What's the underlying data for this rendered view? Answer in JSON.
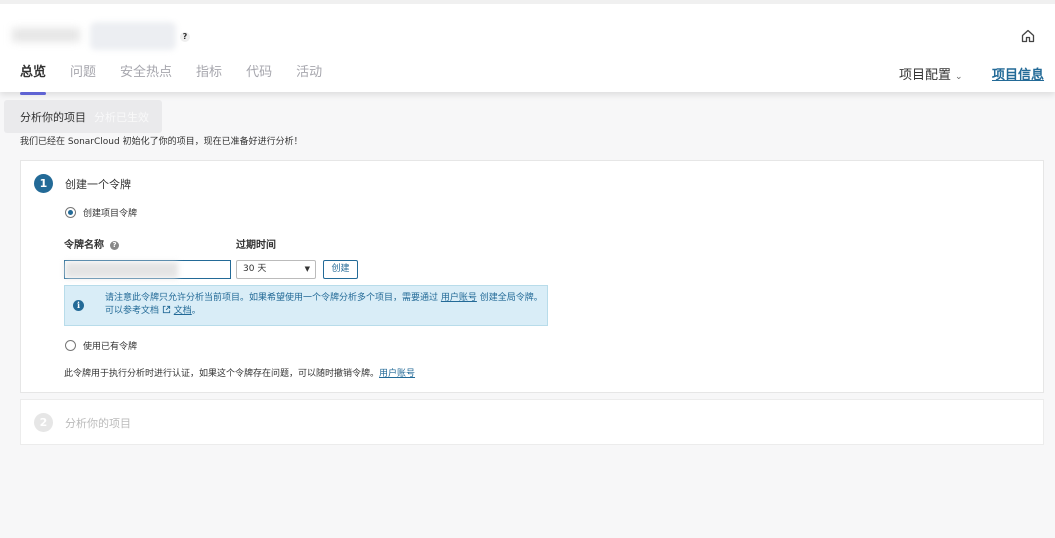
{
  "header": {
    "help_glyph": "?",
    "tabs": [
      {
        "label": "总览"
      },
      {
        "label": "问题"
      },
      {
        "label": "安全热点"
      },
      {
        "label": "指标"
      },
      {
        "label": "代码"
      },
      {
        "label": "活动"
      }
    ],
    "project_config": "项目配置",
    "project_info": "项目信息"
  },
  "page": {
    "title": "分析你的项目",
    "ghost_overlay": "分析已生效",
    "intro": "我们已经在 SonarCloud 初始化了你的项目，现在已准备好进行分析！"
  },
  "step1": {
    "number": "1",
    "title": "创建一个令牌",
    "radio_create": "创建项目令牌",
    "token_name_label": "令牌名称",
    "expiration_label": "过期时间",
    "expiration_value": "30 天",
    "create_button": "创建",
    "info_text_1": "请注意此令牌只允许分析当前项目。如果希望使用一个令牌分析多个项目，需要通过",
    "info_link_1": "用户账号",
    "info_text_2": "创建全局令牌。可以参考文档",
    "info_link_2": "文档",
    "info_text_3": "。",
    "radio_existing": "使用已有令牌",
    "footnote": "此令牌用于执行分析时进行认证，如果这个令牌存在问题，可以随时撤销令牌。",
    "footnote_link": "用户账号"
  },
  "step2": {
    "number": "2",
    "title": "分析你的项目"
  },
  "colors": {
    "accent": "#236a97",
    "tab_indicator": "#5f63d3",
    "info_bg": "#d9edf7"
  }
}
